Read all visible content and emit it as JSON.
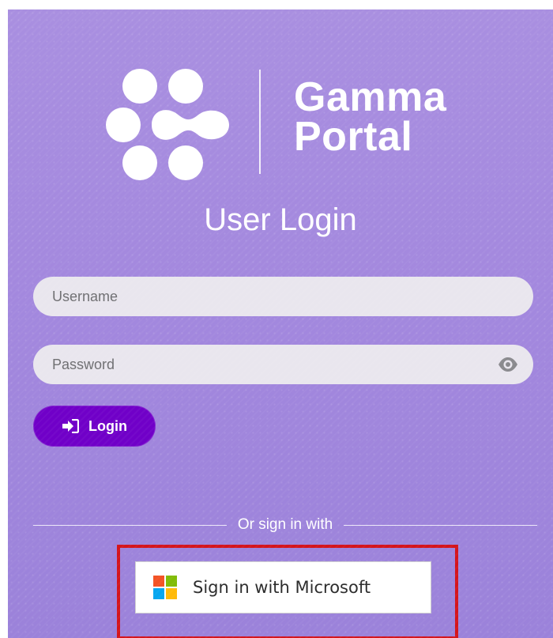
{
  "brand": {
    "name_line1": "Gamma",
    "name_line2": "Portal"
  },
  "login": {
    "title": "User Login",
    "username_placeholder": "Username",
    "password_placeholder": "Password",
    "login_button_label": "Login",
    "divider_text": "Or sign in with",
    "microsoft_button_label": "Sign in with Microsoft"
  },
  "icons": {
    "show_password": "eye-icon",
    "login": "sign-in-icon",
    "microsoft": "microsoft-logo-icon"
  },
  "colors": {
    "background": "#a388de",
    "login_button": "#7000c8",
    "highlight": "#d4141c",
    "ms_red": "#f35325",
    "ms_green": "#81bc06",
    "ms_blue": "#05a6f0",
    "ms_yellow": "#ffba08"
  }
}
